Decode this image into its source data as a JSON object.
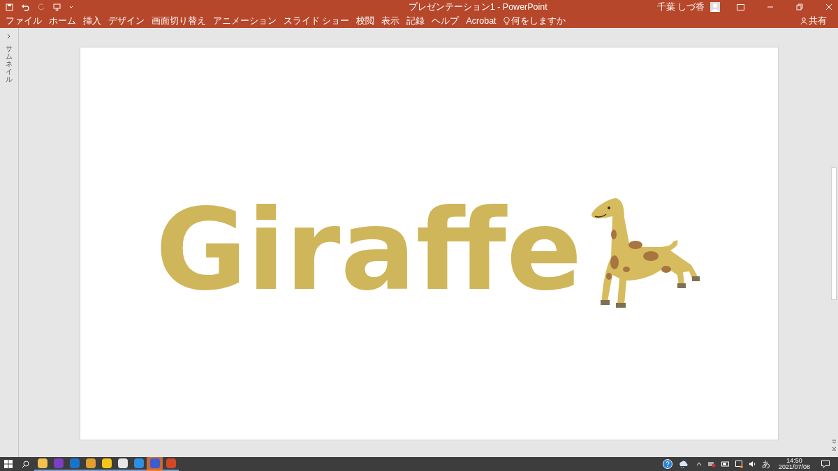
{
  "window": {
    "title": "プレゼンテーション1 - PowerPoint",
    "user": "千葉 しづ香"
  },
  "ribbon": {
    "tabs": [
      "ファイル",
      "ホーム",
      "挿入",
      "デザイン",
      "画面切り替え",
      "アニメーション",
      "スライド ショー",
      "校閲",
      "表示",
      "記録",
      "ヘルプ",
      "Acrobat"
    ],
    "tell_me": "何をしますか",
    "share": "共有"
  },
  "sidebar": {
    "label": "サムネイル"
  },
  "slide": {
    "title": "Giraffe"
  },
  "taskbar": {
    "apps": [
      {
        "active": false
      },
      {
        "active": false
      },
      {
        "active": false
      },
      {
        "active": false
      },
      {
        "active": false
      },
      {
        "active": false
      },
      {
        "active": false
      },
      {
        "active": true
      },
      {
        "active": false
      }
    ],
    "ime": "あ",
    "time": "14:50",
    "date": "2021/07/08"
  }
}
